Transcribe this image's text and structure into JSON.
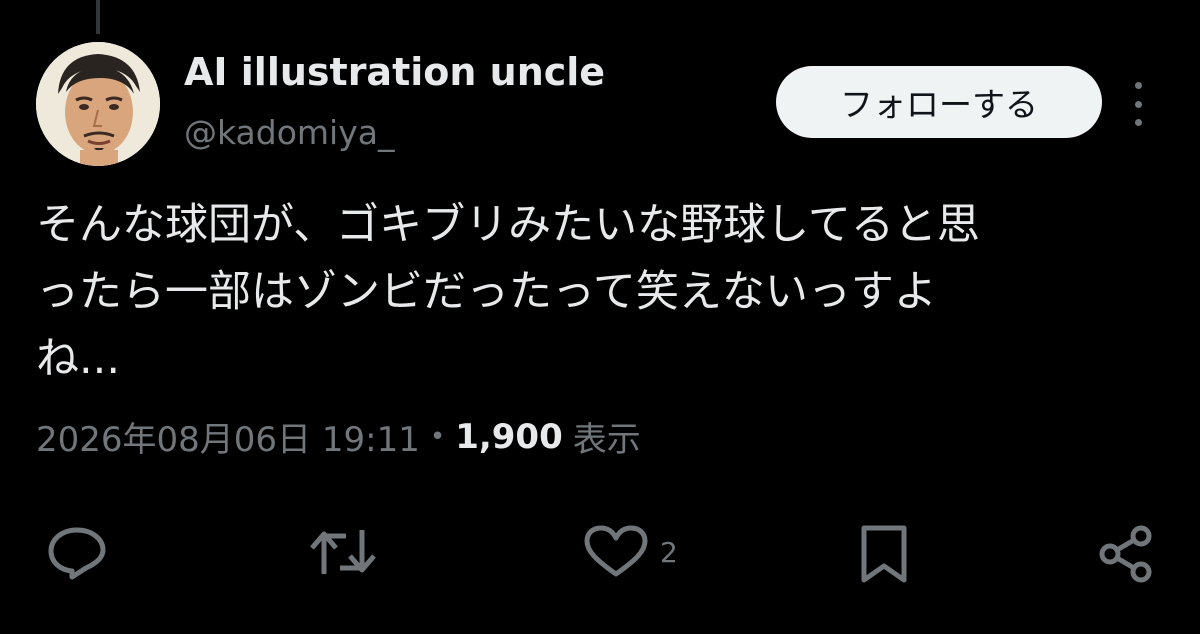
{
  "author": {
    "display_name": "AI illustration uncle",
    "handle": "@kadomiya_"
  },
  "follow_button": {
    "label": "フォローする"
  },
  "tweet": {
    "text_lines": [
      "そんな球団が、ゴキブリみたいな野球してると思",
      "ったら一部はゾンビだったって笑えないっすよ",
      "ね..."
    ]
  },
  "meta": {
    "timestamp": "2026年08月06日 19:11",
    "separator": "•",
    "view_count": "1,900",
    "view_label": "表示"
  },
  "actions": {
    "reply": {
      "icon": "reply-icon"
    },
    "retweet": {
      "icon": "retweet-icon"
    },
    "like": {
      "icon": "heart-icon",
      "count": "2"
    },
    "bookmark": {
      "icon": "bookmark-icon"
    },
    "share": {
      "icon": "share-icon"
    }
  },
  "colors": {
    "background": "#000000",
    "primary_text": "#e7e9ea",
    "secondary_text": "#71767b",
    "follow_button_bg": "#eff3f4"
  }
}
